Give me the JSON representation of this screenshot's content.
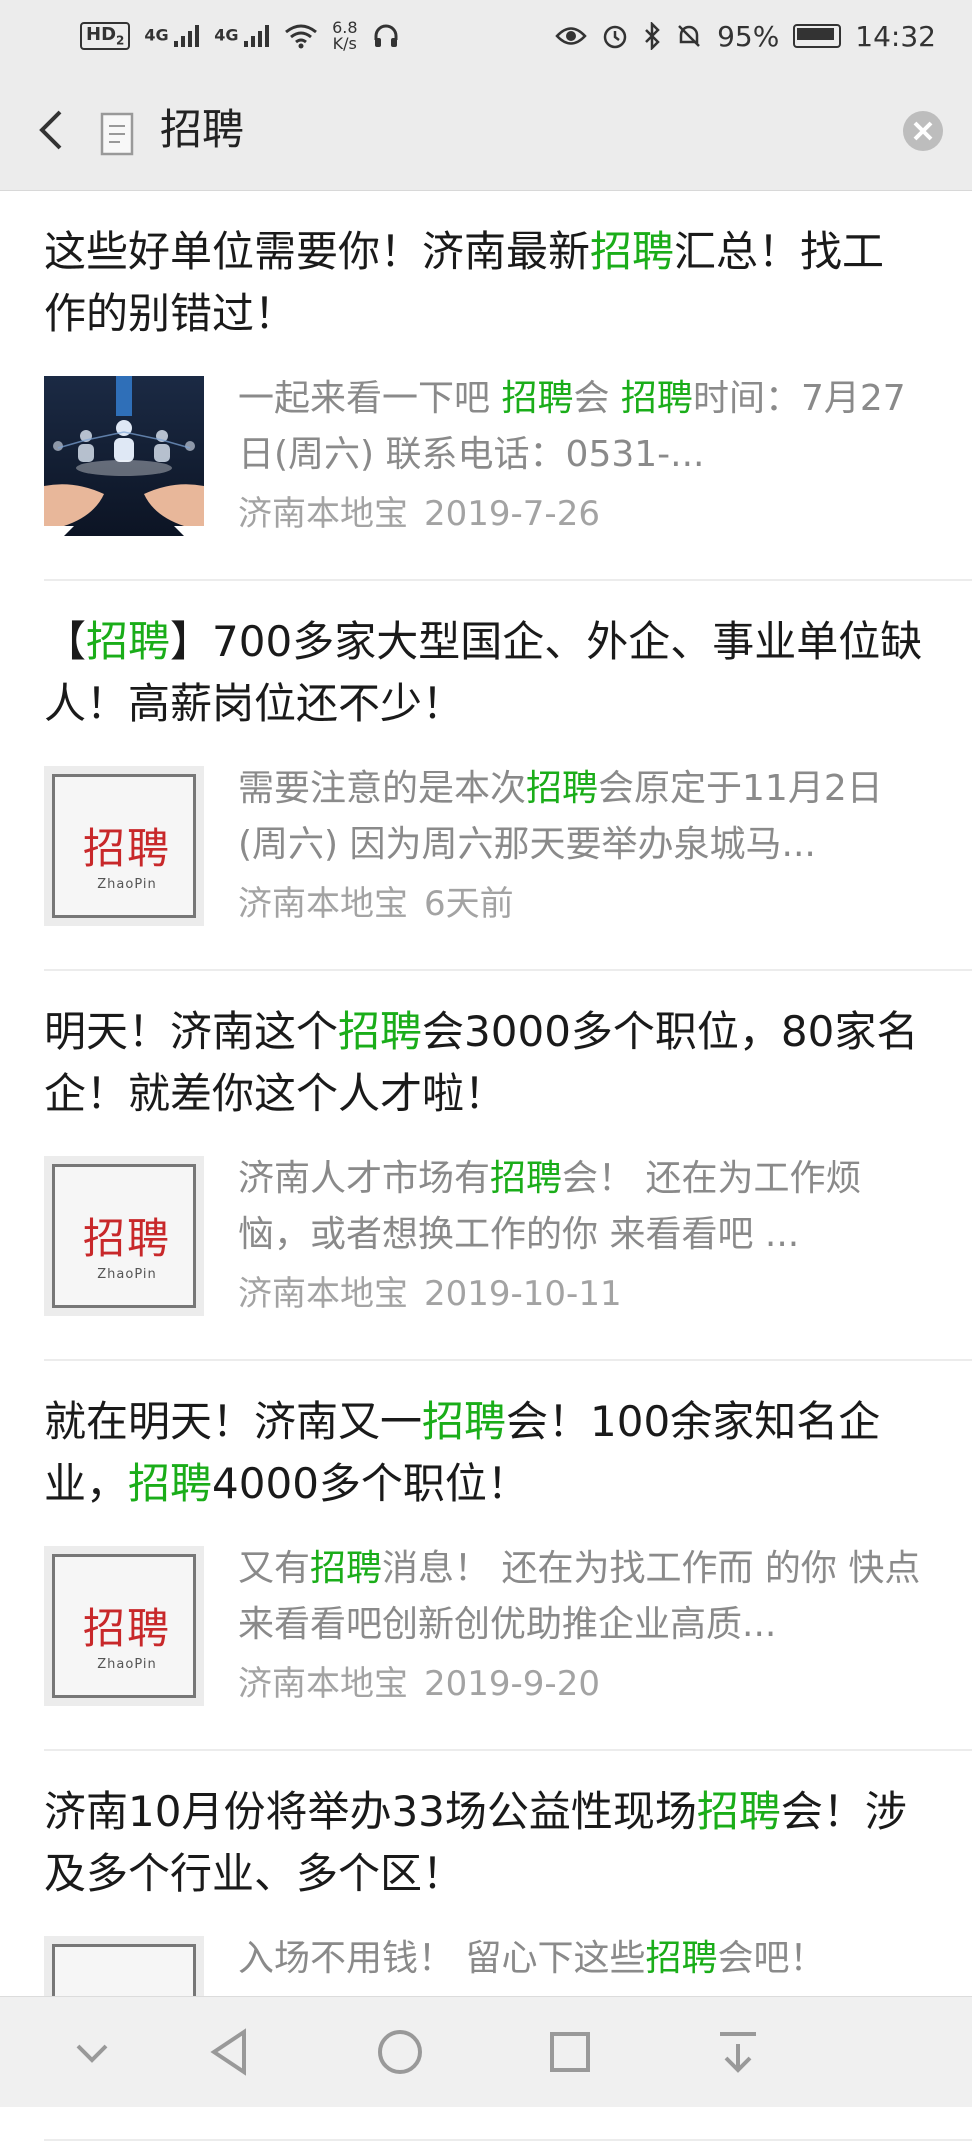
{
  "status_bar": {
    "hd": "HD",
    "hd_sub": "2",
    "signal1": "4G",
    "signal2": "4G",
    "speed_value": "6.8",
    "speed_unit": "K/s",
    "battery": "95%",
    "time": "14:32"
  },
  "nav": {
    "title": "招聘"
  },
  "items": [
    {
      "title_parts": [
        "这些好单位需要你！济南最新",
        "招聘",
        "汇总！找工作的别错过！"
      ],
      "desc_parts": [
        "一起来看一下吧 ",
        "招聘",
        "会 ",
        "招聘",
        "时间：7月27日(周六) 联系电话：0531-..."
      ],
      "source": "济南本地宝",
      "date": "2019-7-26",
      "thumb_type": "photo"
    },
    {
      "title_parts": [
        "【",
        "招聘",
        "】700多家大型国企、外企、事业单位缺人！高薪岗位还不少！"
      ],
      "desc_parts": [
        "需要注意的是本次",
        "招聘",
        "会原定于11月2日(周六) 因为周六那天要举办泉城马..."
      ],
      "source": "济南本地宝",
      "date": "6天前",
      "thumb_type": "zhaopin"
    },
    {
      "title_parts": [
        "明天！济南这个",
        "招聘",
        "会3000多个职位，80家名企！就差你这个人才啦！"
      ],
      "desc_parts": [
        "济南人才市场有",
        "招聘",
        "会！ 还在为工作烦恼，或者想换工作的你 来看看吧 ..."
      ],
      "source": "济南本地宝",
      "date": "2019-10-11",
      "thumb_type": "zhaopin"
    },
    {
      "title_parts": [
        "就在明天！济南又一",
        "招聘",
        "会！100余家知名企业，",
        "招聘",
        "4000多个职位！"
      ],
      "desc_parts": [
        "又有",
        "招聘",
        "消息！ 还在为找工作而 的你 快点来看看吧创新创优助推企业高质..."
      ],
      "source": "济南本地宝",
      "date": "2019-9-20",
      "thumb_type": "zhaopin"
    },
    {
      "title_parts": [
        "济南10月份将举办33场公益性现场",
        "招聘",
        "会！涉及多个行业、多个区！"
      ],
      "desc_parts": [
        "入场不用钱！ 留心下这些",
        "招聘",
        "会吧！"
      ],
      "source": "",
      "date": "",
      "thumb_type": "zhaopin"
    }
  ],
  "thumb_text": {
    "big": "招聘",
    "small": "ZhaoPin"
  },
  "colors": {
    "highlight": "#1aad19",
    "bar_bg": "#ececec",
    "meta": "#a3a3a3",
    "desc": "#8a8a8a"
  },
  "icons": {
    "back": "chevron-left-icon",
    "doc": "document-icon",
    "clear": "clear-circle-icon",
    "sys_nav": [
      "chevron-down-icon",
      "back-triangle-icon",
      "home-circle-icon",
      "recents-square-icon",
      "download-icon"
    ]
  }
}
